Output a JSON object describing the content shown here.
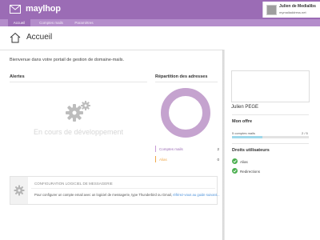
{
  "app": {
    "logo_text": "maylhop"
  },
  "user": {
    "name": "Julien de Medialibs",
    "email": "mymailaddress.net"
  },
  "nav": {
    "tabs": [
      {
        "label": "Accueil",
        "active": true
      },
      {
        "label": "Comptes mails",
        "active": false
      },
      {
        "label": "Paramètres",
        "active": false
      }
    ]
  },
  "page": {
    "title": "Accueil",
    "welcome": "Bienvenue dans votre portail de gestion de domaine-mails."
  },
  "alerts": {
    "title": "Alertes",
    "placeholder": "En cours de développement"
  },
  "distribution": {
    "title": "Répartition des adresses",
    "legend": [
      {
        "label": "Comptes mails",
        "value": "2",
        "color": "#c79bd6"
      },
      {
        "label": "Alias",
        "value": "0",
        "color": "#f0a94b"
      }
    ]
  },
  "config": {
    "title": "CONFIGURATION LOGICIEL DE MESSAGERIE",
    "text": "Pour configurer un compte email avec un logiciel de messagerie, type Thunderbird ou Gmail,",
    "link": "référez-vous au guide suivant..."
  },
  "profile": {
    "name": "Julien PEGE"
  },
  "offer": {
    "title": "Mon offre",
    "label": "5 comptes mails",
    "count": "2 / 5",
    "fill_fraction": 0.4
  },
  "rights": {
    "title": "Droits utilisateurs",
    "items": [
      {
        "label": "Alias"
      },
      {
        "label": "Redirections"
      }
    ]
  },
  "colors": {
    "brand": "#9b6cb5",
    "subnav": "#b48dcb",
    "donut": "#c5a3cf",
    "check": "#4caf50",
    "progress": "#9fd8ea"
  },
  "icons": {
    "logo": "envelope-icon",
    "home": "home-icon",
    "alerts": "gears-icon",
    "config": "gear-icon",
    "rights": "check-circle-icon"
  }
}
